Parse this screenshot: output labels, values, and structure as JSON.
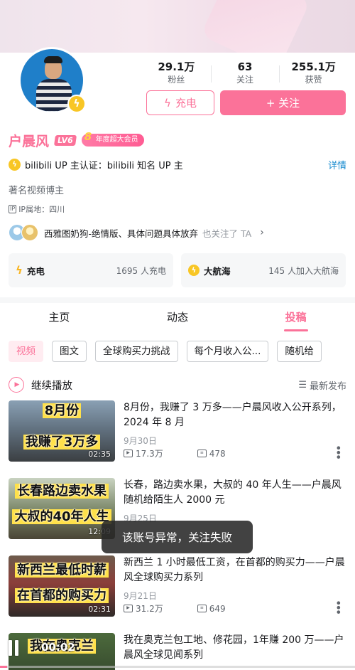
{
  "profile": {
    "fans_count": "29.1万",
    "fans_label": "粉丝",
    "following_count": "63",
    "following_label": "关注",
    "likes_count": "255.1万",
    "likes_label": "获赞",
    "charge_button": "充电",
    "follow_button": "+ 关注",
    "name": "户晨风",
    "level_badge": "LV6",
    "vip_badge": "年度超大会员",
    "vip_years": "8",
    "certification": "bilibili UP 主认证：bilibili 知名 UP 主",
    "detail_link": "详情",
    "signature": "著名视频博主",
    "ip_tag": "IP",
    "ip_location": "IP属地：四川",
    "mutual_names": "西雅图奶狗-绝情版、具体问题具体放弃",
    "mutual_suffix": "也关注了 TA",
    "charge_card_title": "充电",
    "charge_card_sub": "1695 人充电",
    "navy_card_title": "大航海",
    "navy_card_sub": "145 人加入大航海"
  },
  "tabs": [
    {
      "label": "主页"
    },
    {
      "label": "动态"
    },
    {
      "label": "投稿"
    }
  ],
  "chips": [
    {
      "label": "视频"
    },
    {
      "label": "图文"
    },
    {
      "label": "全球购买力挑战"
    },
    {
      "label": "每个月收入公..."
    },
    {
      "label": "随机给"
    }
  ],
  "continue_label": "继续播放",
  "sort_label": "最新发布",
  "videos": [
    {
      "thumb_top": "8月份",
      "thumb_bottom": "我赚了3万多",
      "duration": "02:35",
      "title": "8月份，我赚了 3 万多——户晨风收入公开系列，2024 年 8 月",
      "date": "9月30日",
      "views": "17.3万",
      "danmaku": "478"
    },
    {
      "thumb_top": "长春路边卖水果",
      "thumb_bottom": "大叔的40年人生",
      "duration": "12:09",
      "title": "长春，路边卖水果，大叔的 40 年人生——户晨风随机给陌生人 2000 元",
      "date": "9月25日",
      "views": "",
      "danmaku": ""
    },
    {
      "thumb_top": "新西兰最低时薪",
      "thumb_bottom": "在首都的购买力",
      "duration": "02:31",
      "title": "新西兰 1 小时最低工资，在首都的购买力——户晨风全球购买力系列",
      "date": "9月21日",
      "views": "31.2万",
      "danmaku": "649"
    },
    {
      "thumb_top": "我在奥克兰",
      "thumb_bottom": "",
      "duration": "",
      "title": "我在奥克兰包工地、修花园，1年赚 200 万——户晨风全球见闻系列",
      "date": "",
      "views": "",
      "danmaku": ""
    }
  ],
  "toast": "该账号异常，关注失败",
  "player": {
    "current_time": "00:02",
    "progress": 0.02
  },
  "colors": {
    "accent": "#fb7299",
    "link": "#178bcf",
    "gold": "#f8c625"
  }
}
